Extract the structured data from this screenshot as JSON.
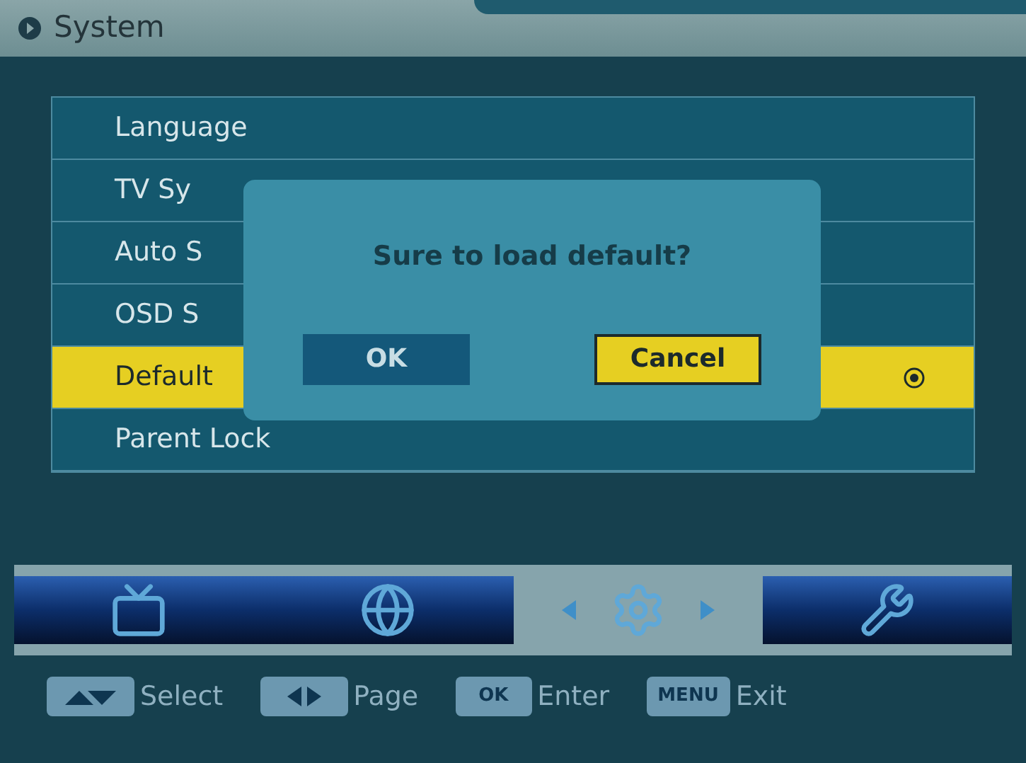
{
  "header": {
    "title": "System"
  },
  "menu": [
    {
      "label": "Language",
      "selected": false
    },
    {
      "label": "TV Sy",
      "selected": false
    },
    {
      "label": "Auto S",
      "selected": false
    },
    {
      "label": "OSD S",
      "selected": false
    },
    {
      "label": "Default",
      "selected": true
    },
    {
      "label": "Parent Lock",
      "selected": false
    }
  ],
  "dialog": {
    "message": "Sure to load default?",
    "buttons": [
      {
        "label": "OK",
        "selected": false
      },
      {
        "label": "Cancel",
        "selected": true
      }
    ]
  },
  "nav": [
    {
      "kind": "tv",
      "selected": false
    },
    {
      "kind": "globe",
      "selected": false
    },
    {
      "kind": "gear",
      "selected": true
    },
    {
      "kind": "tools",
      "selected": false
    }
  ],
  "hints": [
    {
      "kind": "updown",
      "label": "Select"
    },
    {
      "kind": "leftright",
      "label": "Page"
    },
    {
      "kind": "text",
      "key": "OK",
      "label": "Enter"
    },
    {
      "kind": "text",
      "key": "MENU",
      "label": "Exit"
    }
  ]
}
